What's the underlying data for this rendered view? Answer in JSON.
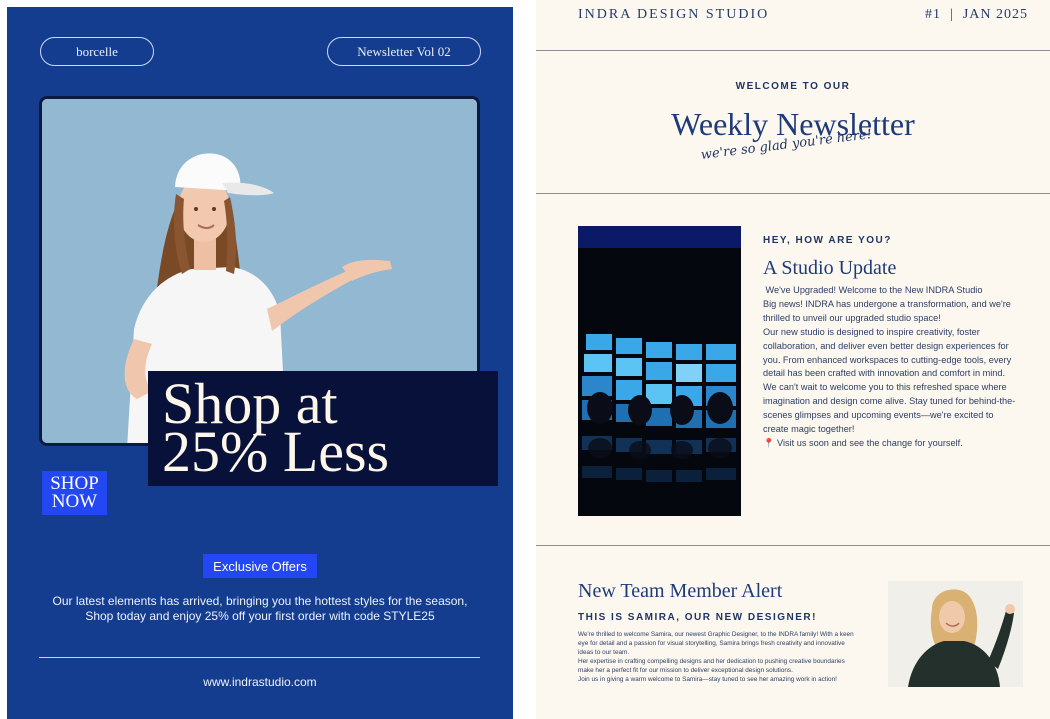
{
  "promo": {
    "brand_pill": "borcelle",
    "volume_pill": "Newsletter Vol 02",
    "headline_line1": "Shop at",
    "headline_line2": "25% Less",
    "shop_now_line1": "SHOP",
    "shop_now_line2": "NOW",
    "exclusive_label": "Exclusive Offers",
    "copy_line1": "Our latest elements has arrived, bringing you the hottest styles for the season,",
    "copy_line2": "Shop today and enjoy 25% off your first order with code STYLE25",
    "website": "www.indrastudio.com",
    "colors": {
      "background": "#143d8f",
      "accent": "#2348f3",
      "headline_box": "#07113a",
      "photo_bg": "#92b8d2"
    },
    "photo_icon": "woman-in-cap-presenting-image"
  },
  "studio": {
    "studio_name": "INDRA DESIGN STUDIO",
    "issue_label": "#1  |  JAN 2025",
    "welcome_label": "WELCOME TO OUR",
    "main_title": "Weekly Newsletter",
    "tagline": "we're so glad you're here!",
    "hey_label": "HEY, HOW ARE YOU?",
    "update_title": "A Studio Update",
    "update_paragraphs": [
      " We've Upgraded! Welcome to the New INDRA Studio",
      "Big news! INDRA has undergone a transformation, and we're thrilled to unveil our upgraded studio space!",
      "Our new studio is designed to inspire creativity, foster collaboration, and deliver even better design experiences for you. From enhanced workspaces to cutting-edge tools, every detail has been crafted with innovation and comfort in mind.",
      "We can't wait to welcome you to this refreshed space where imagination and design come alive. Stay tuned for behind-the-scenes glimpses and upcoming events—we're excited to create magic together!",
      "📍 Visit us soon and see the change for yourself."
    ],
    "team_title": "New Team Member Alert",
    "team_subtitle": "THIS IS SAMIRA, OUR NEW DESIGNER!",
    "team_paragraphs": [
      "We're thrilled to welcome Samira, our newest Graphic Designer, to the INDRA family! With a keen eye for detail and a passion for visual storytelling, Samira brings fresh creativity and innovative ideas to our team.",
      "Her expertise in crafting compelling designs and her dedication to pushing creative boundaries make her a perfect fit for our mission to deliver exceptional design solutions.",
      "Join us in giving a warm welcome to Samira—stay tuned to see her amazing work in action!"
    ],
    "colors": {
      "background": "#fdf8ef",
      "navy": "#1e3a78",
      "rule": "#8a8f9a"
    },
    "studio_photo_icon": "blue-screen-wall-with-chairs-image",
    "samira_photo_icon": "smiling-woman-portrait-image"
  }
}
